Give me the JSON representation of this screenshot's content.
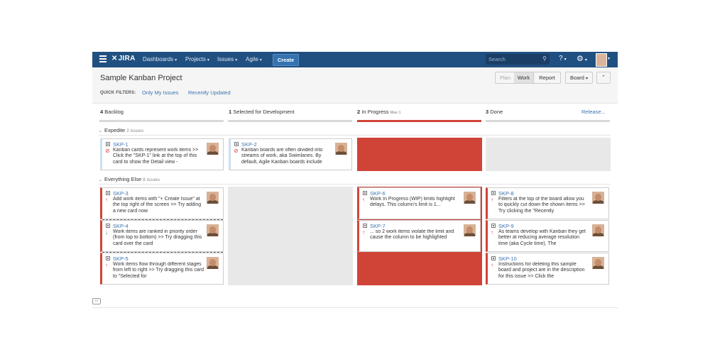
{
  "nav": {
    "logo": "JIRA",
    "menus": [
      "Dashboards",
      "Projects",
      "Issues",
      "Agile"
    ],
    "create_label": "Create",
    "search_placeholder": "Search"
  },
  "header": {
    "title": "Sample Kanban Project",
    "quick_filters_label": "QUICK FILTERS:",
    "quick_filters": [
      "Only My Issues",
      "Recently Updated"
    ],
    "mode_buttons": [
      "Plan",
      "Work",
      "Report"
    ],
    "active_mode": "Work",
    "board_label": "Board"
  },
  "columns": [
    {
      "count": "4",
      "name": "Backlog",
      "max": ""
    },
    {
      "count": "1",
      "name": "Selected for Development",
      "max": ""
    },
    {
      "count": "2",
      "name": "In Progress",
      "max": "Max 1"
    },
    {
      "count": "3",
      "name": "Done",
      "max": ""
    }
  ],
  "release_label": "Release...",
  "swimlanes": [
    {
      "name": "Expedite",
      "count": "2 issues"
    },
    {
      "name": "Everything Else",
      "count": "8 issues"
    }
  ],
  "cards": {
    "skp1": {
      "key": "SKP-1",
      "summary": "Kanban cards represent work items >> Click the \"SKP-1\" link at the top of this card to show the Detail view -"
    },
    "skp2": {
      "key": "SKP-2",
      "summary": "Kanban boards are often divided into streams of work, aka Swimlanes. By default, Agile Kanban boards include"
    },
    "skp3": {
      "key": "SKP-3",
      "summary": "Add work items with \"+ Create Issue\" at the top right of the screen >> Try adding a new card now"
    },
    "skp4": {
      "key": "SKP-4",
      "summary": "Work items are ranked in priority order (from top to bottom) >> Try dragging this card over the card"
    },
    "skp5": {
      "key": "SKP-5",
      "summary": "Work items flow through different stages from left to right >> Try dragging this card to \"Selected for"
    },
    "skp6": {
      "key": "SKP-6",
      "summary": "Work In Progress (WIP) limits highlight delays. This column's limit is 1..."
    },
    "skp7": {
      "key": "SKP-7",
      "summary": "... so 2 work items violate the limit and cause the column to be highlighted"
    },
    "skp8": {
      "key": "SKP-8",
      "summary": "Filters at the top of the board allow you to quickly cut down the shown items >> Try clicking the \"Recently"
    },
    "skp9": {
      "key": "SKP-9",
      "summary": "As teams develop with Kanban they get better at reducing average resolution time (aka Cycle time). The"
    },
    "skp10": {
      "key": "SKP-10",
      "summary": "Instructions for deleting this sample board and project are in the description for this issue >> Click the"
    }
  },
  "colors": {
    "nav": "#205081",
    "link": "#3b73af",
    "wip_exceeded": "#d04437"
  }
}
